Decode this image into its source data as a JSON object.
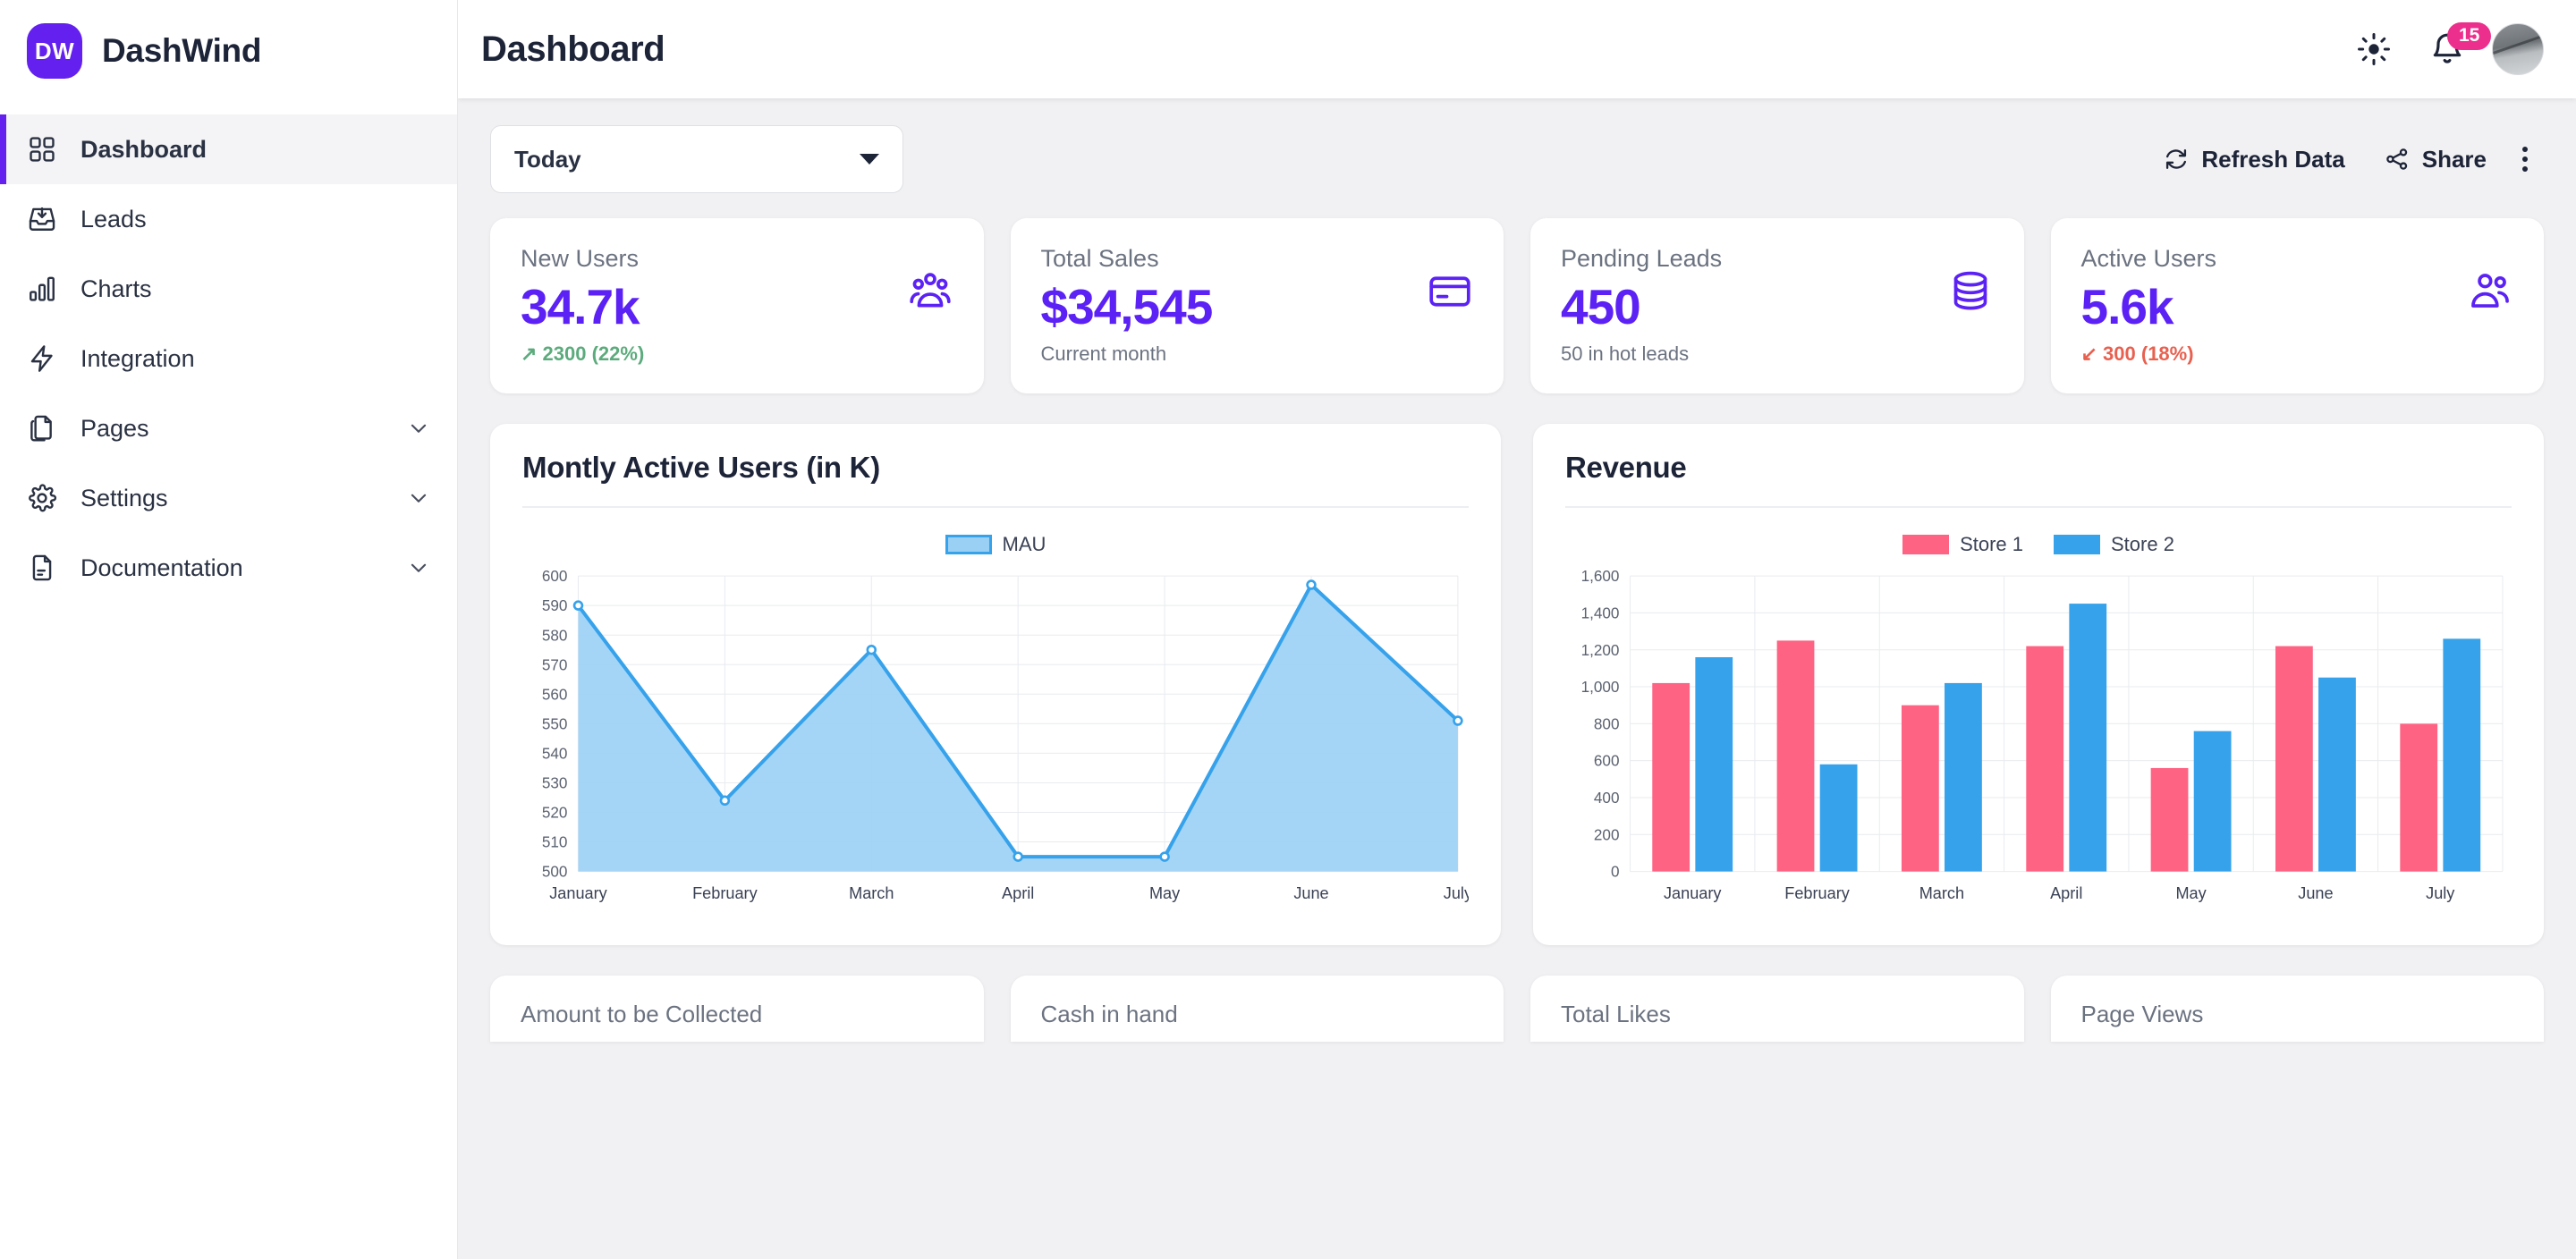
{
  "brand": {
    "badge": "DW",
    "name": "DashWind"
  },
  "sidebar": {
    "items": [
      {
        "label": "Dashboard",
        "icon": "grid-icon",
        "active": true,
        "expandable": false
      },
      {
        "label": "Leads",
        "icon": "inbox-icon",
        "active": false,
        "expandable": false
      },
      {
        "label": "Charts",
        "icon": "bar-chart-icon",
        "active": false,
        "expandable": false
      },
      {
        "label": "Integration",
        "icon": "bolt-icon",
        "active": false,
        "expandable": false
      },
      {
        "label": "Pages",
        "icon": "documents-icon",
        "active": false,
        "expandable": true
      },
      {
        "label": "Settings",
        "icon": "gear-icon",
        "active": false,
        "expandable": true
      },
      {
        "label": "Documentation",
        "icon": "document-icon",
        "active": false,
        "expandable": true
      }
    ]
  },
  "topbar": {
    "title": "Dashboard",
    "theme_icon": "sun-icon",
    "notification_icon": "bell-icon",
    "notification_count": "15",
    "avatar_icon": "avatar"
  },
  "toolbar": {
    "period_selected": "Today",
    "refresh_label": "Refresh Data",
    "refresh_icon": "refresh-icon",
    "share_label": "Share",
    "share_icon": "share-nodes-icon",
    "more_icon": "dots-vertical-icon"
  },
  "stats": [
    {
      "title": "New Users",
      "value": "34.7k",
      "sub": "2300 (22%)",
      "trend": "up",
      "icon": "users-group-icon"
    },
    {
      "title": "Total Sales",
      "value": "$34,545",
      "sub": "Current month",
      "trend": "none",
      "icon": "credit-card-icon"
    },
    {
      "title": "Pending Leads",
      "value": "450",
      "sub": "50 in hot leads",
      "trend": "none",
      "icon": "database-icon"
    },
    {
      "title": "Active Users",
      "value": "5.6k",
      "sub": "300 (18%)",
      "trend": "down",
      "icon": "users-icon"
    }
  ],
  "colors": {
    "brand_purple": "#6320ee",
    "stat_value": "#5b21f5",
    "up_green": "#5cab7d",
    "down_red": "#e8604f",
    "badge_pink": "#ec2f8c",
    "line_blue": "#36a2eb",
    "area_blue": "#9bd0f5",
    "bar_pink": "#ff6384",
    "bar_blue": "#36a2eb"
  },
  "bottom_cards": [
    {
      "title": "Amount to be Collected"
    },
    {
      "title": "Cash in hand"
    },
    {
      "title": "Total Likes"
    },
    {
      "title": "Page Views"
    }
  ],
  "chart_data": [
    {
      "id": "mau",
      "type": "area",
      "title": "Montly Active Users (in K)",
      "categories": [
        "January",
        "February",
        "March",
        "April",
        "May",
        "June",
        "July"
      ],
      "series": [
        {
          "name": "MAU",
          "values": [
            590,
            524,
            575,
            505,
            505,
            597,
            551
          ]
        }
      ],
      "legend": [
        "MAU"
      ],
      "legend_position": "top",
      "ylim": [
        500,
        600
      ],
      "yticks": [
        500,
        510,
        520,
        530,
        540,
        550,
        560,
        570,
        580,
        590,
        600
      ],
      "ytick_labels": [
        "500",
        "510",
        "520",
        "530",
        "540",
        "550",
        "560",
        "570",
        "580",
        "590",
        "600"
      ],
      "xlabel": "",
      "ylabel": "",
      "grid": true
    },
    {
      "id": "revenue",
      "type": "bar",
      "title": "Revenue",
      "categories": [
        "January",
        "February",
        "March",
        "April",
        "May",
        "June",
        "July"
      ],
      "series": [
        {
          "name": "Store 1",
          "values": [
            1020,
            1250,
            900,
            1220,
            560,
            1220,
            800
          ]
        },
        {
          "name": "Store 2",
          "values": [
            1160,
            580,
            1020,
            1450,
            760,
            1050,
            1260
          ]
        }
      ],
      "legend": [
        "Store 1",
        "Store 2"
      ],
      "legend_position": "top",
      "ylim": [
        0,
        1600
      ],
      "yticks": [
        0,
        200,
        400,
        600,
        800,
        1000,
        1200,
        1400,
        1600
      ],
      "ytick_labels": [
        "0",
        "200",
        "400",
        "600",
        "800",
        "1,000",
        "1,200",
        "1,400",
        "1,600"
      ],
      "xlabel": "",
      "ylabel": "",
      "grid": true
    }
  ]
}
